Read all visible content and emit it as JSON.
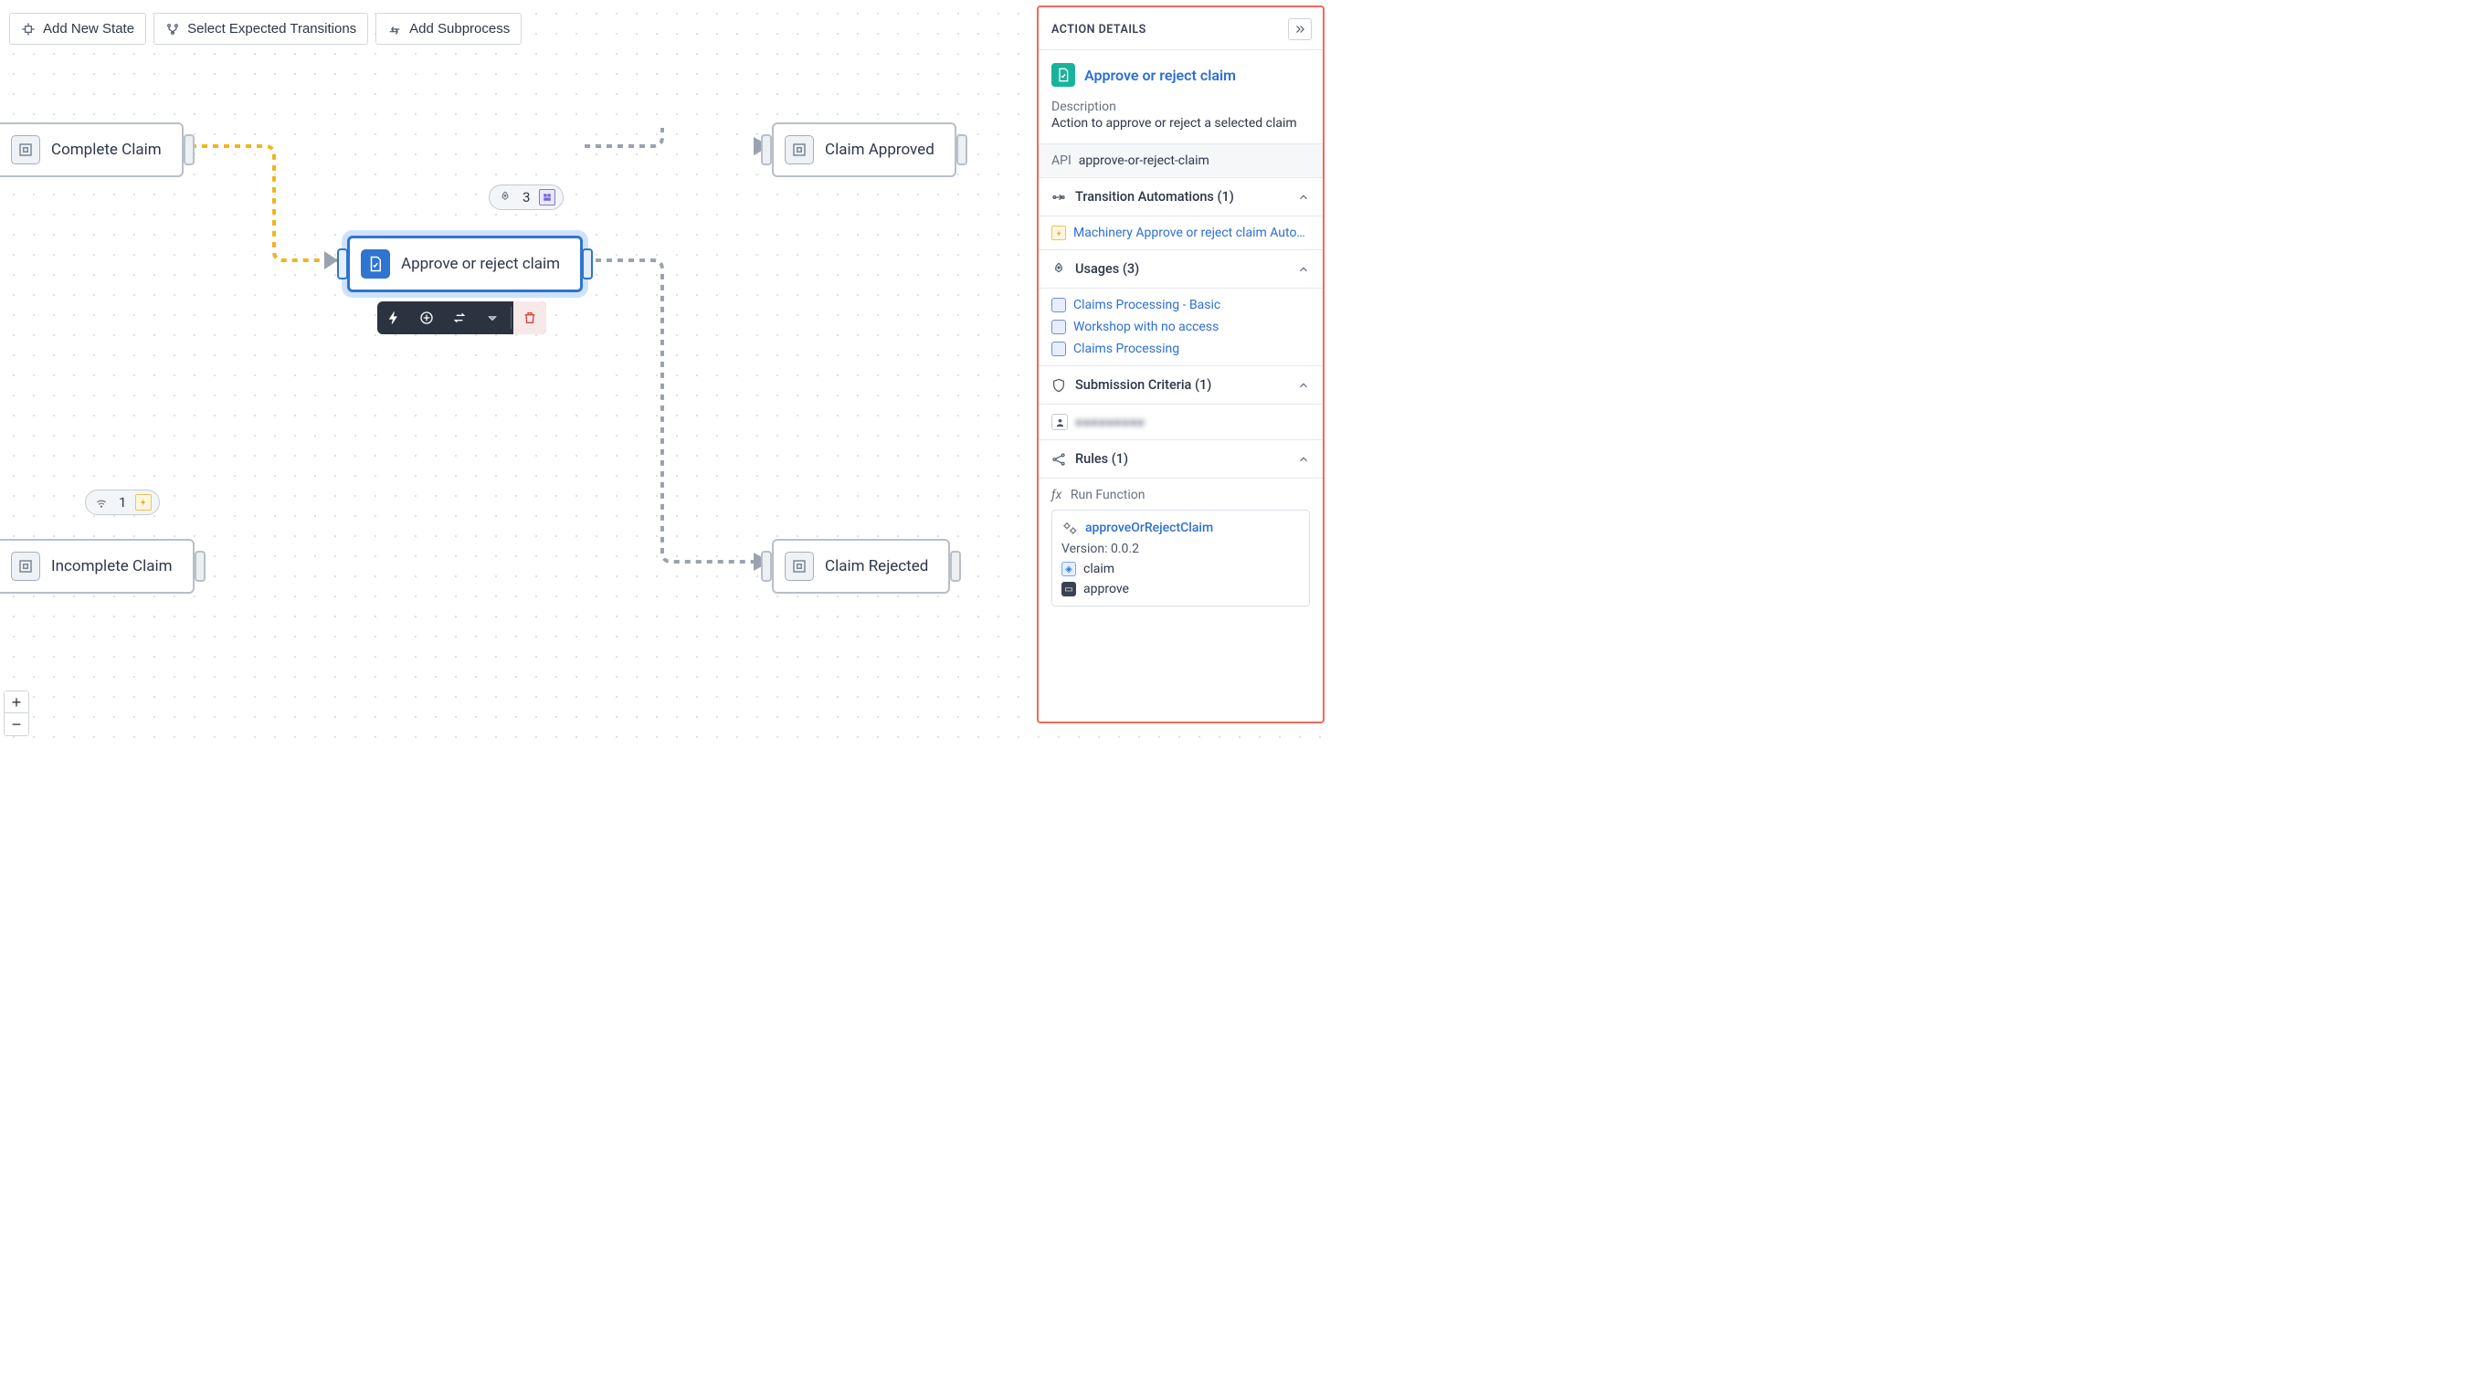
{
  "toolbar": {
    "add_state": "Add New State",
    "select_transitions": "Select Expected Transitions",
    "add_subprocess": "Add Subprocess"
  },
  "zoom": {
    "in": "+",
    "out": "−"
  },
  "nodes": {
    "complete_claim": "Complete Claim",
    "incomplete_claim": "Incomplete Claim",
    "approve_reject": "Approve or reject claim",
    "claim_approved": "Claim Approved",
    "claim_rejected": "Claim Rejected"
  },
  "badges": {
    "action_count": "3",
    "incomplete_count": "1"
  },
  "panel": {
    "title": "ACTION DETAILS",
    "name": "Approve or reject claim",
    "description_label": "Description",
    "description": "Action to approve or reject a selected claim",
    "api_label": "API",
    "api_value": "approve-or-reject-claim",
    "sections": {
      "transition_automations": "Transition Automations (1)",
      "usages": "Usages (3)",
      "submission_criteria": "Submission Criteria (1)",
      "rules": "Rules (1)"
    },
    "transition_link": "Machinery Approve or reject claim Auto…",
    "usages_links": [
      "Claims Processing - Basic",
      "Workshop with no access",
      "Claims Processing"
    ],
    "submission_blurred": "■■■■■■■■■",
    "rules_fn_label": "Run Function",
    "fn": {
      "name": "approveOrRejectClaim",
      "version_label": "Version: 0.0.2",
      "params": [
        "claim",
        "approve"
      ]
    }
  }
}
